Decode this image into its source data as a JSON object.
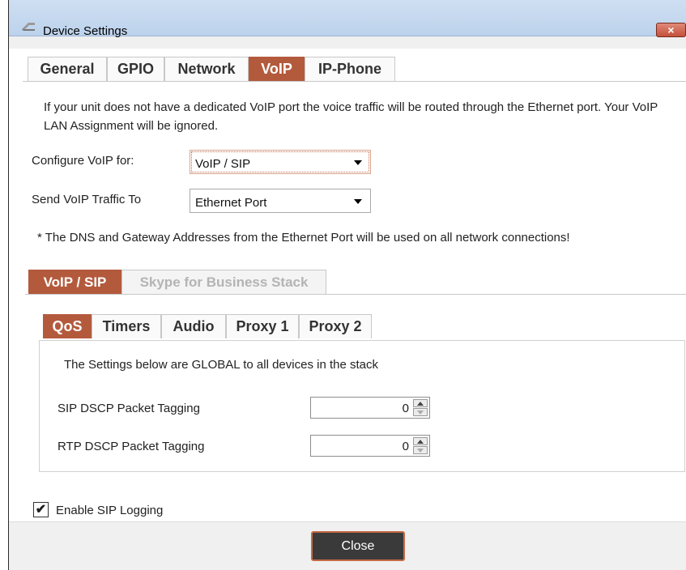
{
  "window": {
    "title": "Device Settings",
    "icon": "app-icon",
    "close_icon": "×"
  },
  "tabs": [
    "General",
    "GPIO",
    "Network",
    "VoIP",
    "IP-Phone"
  ],
  "active_tab": "VoIP",
  "info_text": "If your unit does not have a dedicated VoIP port the voice traffic will be routed through the Ethernet port.  Your VoIP LAN Assignment will be ignored.",
  "configure": {
    "label": "Configure VoIP for:",
    "value": "VoIP / SIP"
  },
  "traffic": {
    "label": "Send VoIP Traffic To",
    "value": "Ethernet Port"
  },
  "note": "* The DNS and Gateway Addresses from the Ethernet Port will be used on all network connections!",
  "sub_tabs": [
    "VoIP / SIP",
    "Skype for Business Stack"
  ],
  "inner_tabs": [
    "QoS",
    "Timers",
    "Audio",
    "Proxy 1",
    "Proxy 2"
  ],
  "qos": {
    "heading": "The Settings below are GLOBAL to all devices in the stack",
    "sip_label": "SIP DSCP Packet Tagging",
    "sip_value": "0",
    "rtp_label": "RTP DSCP Packet Tagging",
    "rtp_value": "0"
  },
  "logging": {
    "label": "Enable SIP Logging",
    "checked": true,
    "check_glyph": "✔"
  },
  "buttons": {
    "close": "Close"
  },
  "colors": {
    "accent": "#b35a3d",
    "button_border": "#c56a44"
  }
}
